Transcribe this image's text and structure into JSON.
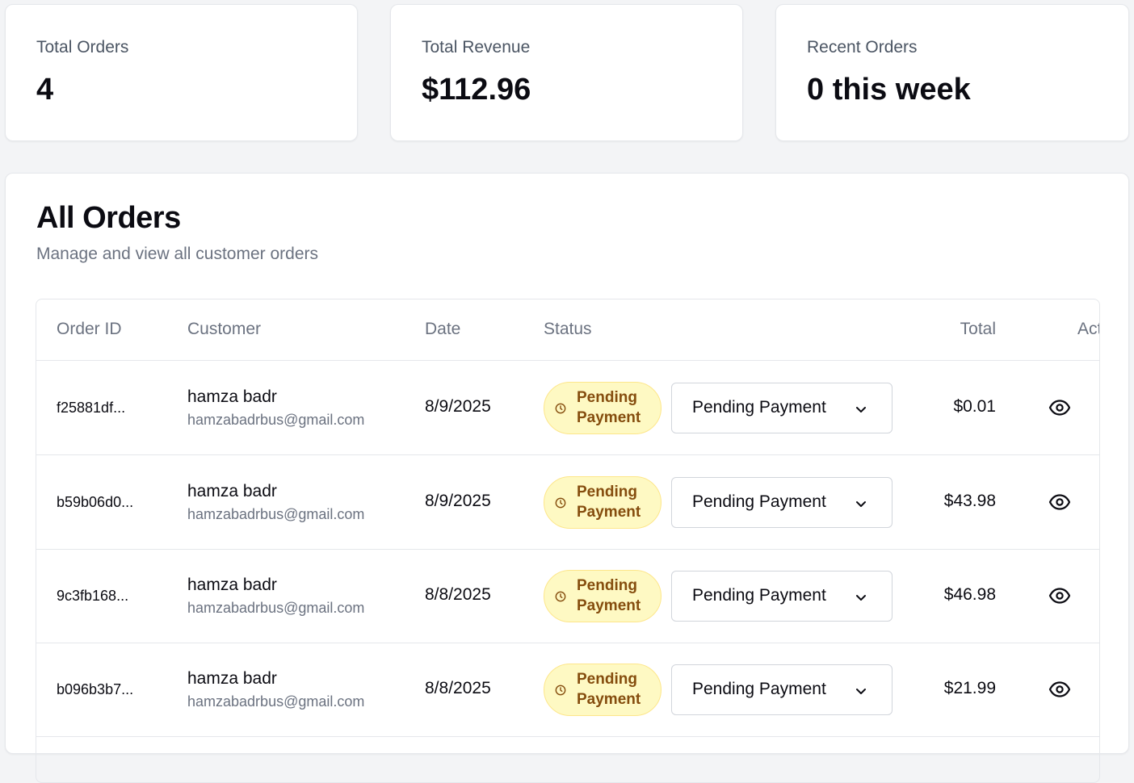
{
  "stats": [
    {
      "label": "Total Orders",
      "value": "4"
    },
    {
      "label": "Total Revenue",
      "value": "$112.96"
    },
    {
      "label": "Recent Orders",
      "value": "0 this week"
    }
  ],
  "orders": {
    "title": "All Orders",
    "subtitle": "Manage and view all customer orders",
    "columns": {
      "order_id": "Order ID",
      "customer": "Customer",
      "date": "Date",
      "status": "Status",
      "total": "Total",
      "actions": "Actions"
    },
    "rows": [
      {
        "id": "f25881df...",
        "name": "hamza badr",
        "email": "hamzabadrbus@gmail.com",
        "date": "8/9/2025",
        "status_badge": "Pending Payment",
        "status_select": "Pending Payment",
        "total": "$0.01"
      },
      {
        "id": "b59b06d0...",
        "name": "hamza badr",
        "email": "hamzabadrbus@gmail.com",
        "date": "8/9/2025",
        "status_badge": "Pending Payment",
        "status_select": "Pending Payment",
        "total": "$43.98"
      },
      {
        "id": "9c3fb168...",
        "name": "hamza badr",
        "email": "hamzabadrbus@gmail.com",
        "date": "8/8/2025",
        "status_badge": "Pending Payment",
        "status_select": "Pending Payment",
        "total": "$46.98"
      },
      {
        "id": "b096b3b7...",
        "name": "hamza badr",
        "email": "hamzabadrbus@gmail.com",
        "date": "8/8/2025",
        "status_badge": "Pending Payment",
        "status_select": "Pending Payment",
        "total": "$21.99"
      }
    ]
  },
  "icons": {
    "status": "clock-icon",
    "select": "chevron-down-icon",
    "view": "eye-icon"
  },
  "colors": {
    "badge_bg": "#fef9c3",
    "badge_text": "#854d0e",
    "page_bg": "#f3f4f6"
  }
}
